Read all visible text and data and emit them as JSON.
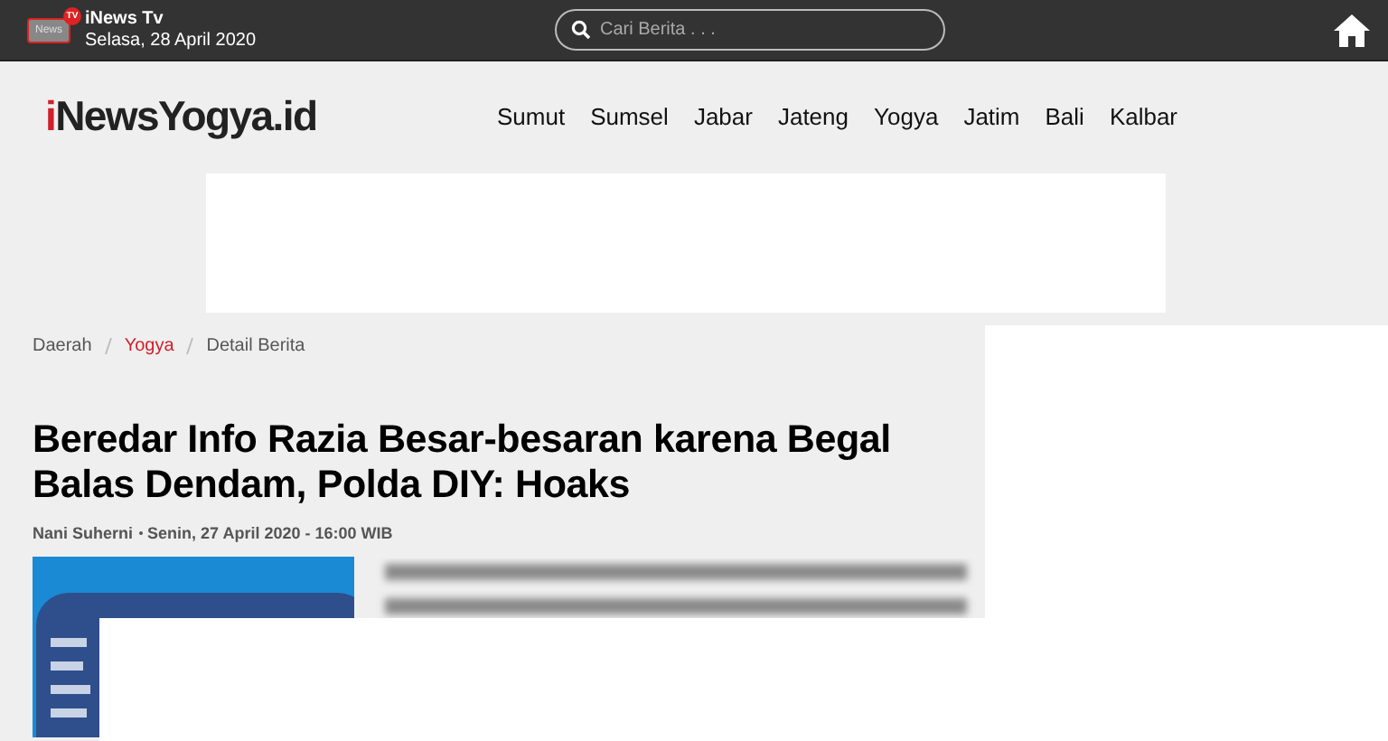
{
  "top_bar": {
    "logo_screen": "News",
    "logo_badge": "TV",
    "channel": "iNews Tv",
    "date": "Selasa, 28 April 2020",
    "search": {
      "placeholder": "Cari Berita . . ."
    }
  },
  "header": {
    "logo_prefix": "i",
    "logo_name": "NewsYogya.id",
    "nav": [
      {
        "label": "Sumut"
      },
      {
        "label": "Sumsel"
      },
      {
        "label": "Jabar"
      },
      {
        "label": "Jateng"
      },
      {
        "label": "Yogya"
      },
      {
        "label": "Jatim"
      },
      {
        "label": "Bali"
      },
      {
        "label": "Kalbar"
      }
    ]
  },
  "breadcrumb": [
    {
      "label": "Daerah",
      "highlighted": false
    },
    {
      "label": "Yogya",
      "highlighted": true
    },
    {
      "label": "Detail Berita",
      "highlighted": false
    }
  ],
  "article": {
    "title": "Beredar Info Razia Besar-besaran karena Begal Balas Dendam, Polda DIY: Hoaks",
    "author": "Nani Suherni",
    "date": "Senin, 27 April 2020 - 16:00 WIB"
  }
}
